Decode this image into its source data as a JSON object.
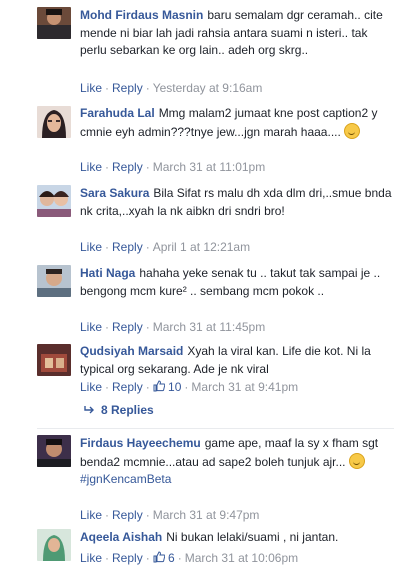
{
  "comments": [
    {
      "author": "Mohd Firdaus Masnin",
      "text": "baru semalam dgr ceramah.. cite mende ni biar lah jadi rahsia antara suami n isteri.. tak perlu sebarkan ke org lain.. adeh org skrg..",
      "like": "Like",
      "reply": "Reply",
      "time": "Yesterday at 9:16am"
    },
    {
      "author": "Farahuda Lal",
      "text": "Mmg malam2 jumaat kne post caption2 y cmnie eyh admin???tnye jew...jgn marah haaa....",
      "like": "Like",
      "reply": "Reply",
      "time": "March 31 at 11:01pm"
    },
    {
      "author": "Sara Sakura",
      "text": "Bila Sifat rs malu dh xda dlm dri,..smue bnda nk crita,..xyah la nk aibkn dri sndri bro!",
      "like": "Like",
      "reply": "Reply",
      "time": "April 1 at 12:21am"
    },
    {
      "author": "Hati Naga",
      "text": "hahaha yeke senak tu .. takut tak sampai je .. bengong mcm kure² .. sembang mcm pokok ..",
      "like": "Like",
      "reply": "Reply",
      "time": "March 31 at 11:45pm"
    },
    {
      "author": "Qudsiyah Marsaid",
      "text": "Xyah la viral kan. Life die kot. Ni la typical org sekarang. Ade je nk viral",
      "like": "Like",
      "reply": "Reply",
      "likes": "10",
      "time": "March 31 at 9:41pm",
      "replies": "8 Replies"
    },
    {
      "author": "Firdaus Hayeechemu",
      "text": "game ape, maaf la sy x fham sgt benda2 mcmnie...atau ad sape2 boleh tunjuk ajr...",
      "hashtag": "#jgnKencamBeta",
      "like": "Like",
      "reply": "Reply",
      "time": "March 31 at 9:47pm"
    },
    {
      "author": "Aqeela Aishah",
      "text": "Ni bukan lelaki/suami , ni jantan.",
      "like": "Like",
      "reply": "Reply",
      "likes": "6",
      "time": "March 31 at 10:06pm"
    }
  ],
  "icons": {
    "thumbs_up": "thumbs-up-icon",
    "reply_arrow": "reply-arrow-icon",
    "emoji": "smile-emoji-icon"
  },
  "colors": {
    "link": "#365899",
    "meta": "#90949c",
    "text": "#1d2129"
  }
}
